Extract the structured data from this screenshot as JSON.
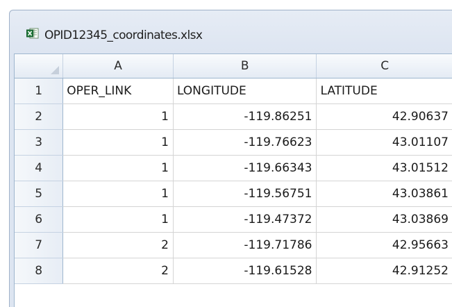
{
  "window": {
    "title": "OPID12345_coordinates.xlsx",
    "file_icon": "excel-file-icon"
  },
  "sheet": {
    "columns": [
      "A",
      "B",
      "C"
    ],
    "rows": [
      {
        "num": "1",
        "cells": [
          "OPER_LINK",
          "LONGITUDE",
          "LATITUDE"
        ]
      },
      {
        "num": "2",
        "cells": [
          "1",
          "-119.86251",
          "42.90637"
        ]
      },
      {
        "num": "3",
        "cells": [
          "1",
          "-119.76623",
          "43.01107"
        ]
      },
      {
        "num": "4",
        "cells": [
          "1",
          "-119.66343",
          "43.01512"
        ]
      },
      {
        "num": "5",
        "cells": [
          "1",
          "-119.56751",
          "43.03861"
        ]
      },
      {
        "num": "6",
        "cells": [
          "1",
          "-119.47372",
          "43.03869"
        ]
      },
      {
        "num": "7",
        "cells": [
          "2",
          "-119.71786",
          "42.95663"
        ]
      },
      {
        "num": "8",
        "cells": [
          "2",
          "-119.61528",
          "42.91252"
        ]
      }
    ]
  },
  "colors": {
    "header_border": "#9eb6ce",
    "gridline": "#d4d4d4",
    "excel_green": "#1f7a3a"
  }
}
